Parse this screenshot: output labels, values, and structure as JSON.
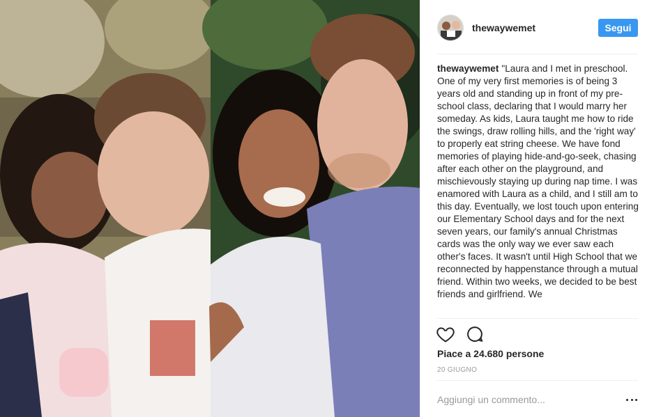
{
  "post": {
    "username": "thewaywemet",
    "follow_label": "Segui",
    "caption_username": "thewaywemet",
    "caption_text": "\"Laura and I met in preschool. One of my very first memories is of being 3 years old and standing up in front of my pre-school class, declaring that I would marry her someday. As kids, Laura taught me how to ride the swings, draw rolling hills, and the 'right way' to properly eat string cheese. We have fond memories of playing hide-and-go-seek, chasing after each other on the playground, and mischievously staying up during nap time. I was enamored with Laura as a child, and I still am to this day. Eventually, we lost touch upon entering our Elementary School days and for the next seven years, our family's annual Christmas cards was the only way we ever saw each other's faces. It wasn't until High School that we reconnected by happenstance through a mutual friend. Within two weeks, we decided to be best friends and girlfriend. We",
    "likes_text": "Piace a 24.680 persone",
    "date": "20 GIUGNO",
    "comment_placeholder": "Aggiungi un commento..."
  },
  "icons": {
    "like": "heart-icon",
    "comment": "comment-bubble-icon",
    "more": "more-options-icon"
  },
  "colors": {
    "follow_button": "#3897f0",
    "text": "#262626",
    "muted": "#999999",
    "divider": "#efefef"
  }
}
